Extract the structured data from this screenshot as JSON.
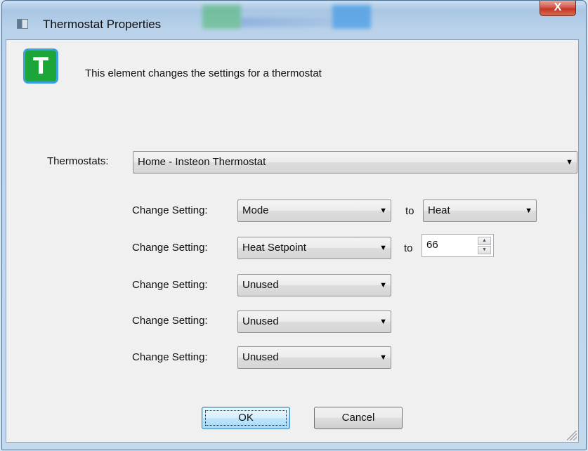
{
  "window": {
    "title": "Thermostat Properties",
    "close_label": "X",
    "logo_letter": "T",
    "description": "This element changes the settings for a thermostat"
  },
  "thermostats": {
    "label": "Thermostats:",
    "selected": "Home - Insteon Thermostat"
  },
  "settings": [
    {
      "label": "Change Setting:",
      "setting": "Mode",
      "to": "to",
      "value": "Heat",
      "value_type": "dropdown"
    },
    {
      "label": "Change Setting:",
      "setting": "Heat Setpoint",
      "to": "to",
      "value": "66",
      "value_type": "spinner"
    },
    {
      "label": "Change Setting:",
      "setting": "Unused"
    },
    {
      "label": "Change Setting:",
      "setting": "Unused"
    },
    {
      "label": "Change Setting:",
      "setting": "Unused"
    }
  ],
  "buttons": {
    "ok": "OK",
    "cancel": "Cancel"
  },
  "icons": {
    "dropdown": "chevron-down-icon",
    "spin_up": "spin-up-icon",
    "spin_down": "spin-down-icon",
    "logo": "thermostat-logo-icon",
    "app": "window-app-icon"
  },
  "colors": {
    "logo_green": "#1ca63a",
    "logo_border": "#3aa1e0",
    "close_red": "#c4372a",
    "default_button": "#bee6fd"
  }
}
